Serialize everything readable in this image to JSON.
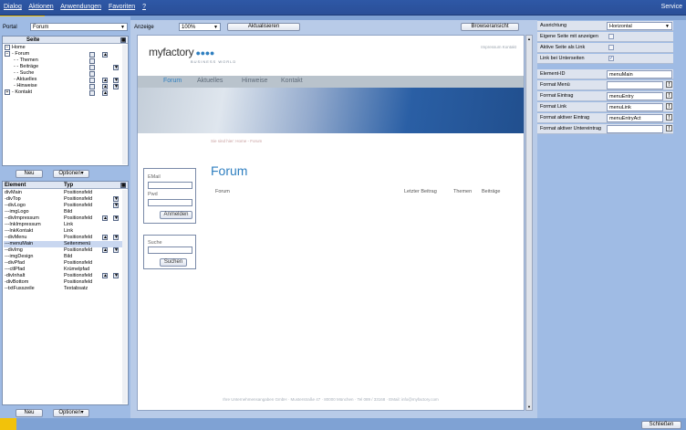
{
  "menubar": {
    "items": [
      "Dialog",
      "Aktionen",
      "Anwendungen",
      "Favoriten",
      "?"
    ],
    "service": "Service"
  },
  "left": {
    "portal_label": "Portal",
    "portal_value": "Forum",
    "tree_header": "Seite",
    "tree_items": [
      "Home",
      "- Forum",
      "- - Themen",
      "- - Beiträge",
      "- - Suche",
      "- Aktuelles",
      "- Hinweise",
      "- Kontakt"
    ],
    "new_label": "Neu",
    "options_label": "Optionen▾",
    "table_headers": [
      "Element",
      "Typ"
    ],
    "rows": [
      {
        "e": "divMain",
        "t": "Positionsfeld"
      },
      {
        "e": "-divTop",
        "t": "Positionsfeld"
      },
      {
        "e": "--divLogo",
        "t": "Positionsfeld"
      },
      {
        "e": "---imgLogo",
        "t": "Bild"
      },
      {
        "e": "--divImpressum",
        "t": "Positionsfeld"
      },
      {
        "e": "---lnkImpressum",
        "t": "Link"
      },
      {
        "e": "---lnkKontakt",
        "t": "Link"
      },
      {
        "e": "--divMenu",
        "t": "Positionsfeld"
      },
      {
        "e": "---menuMain",
        "t": "Seitenmenü"
      },
      {
        "e": "--divImg",
        "t": "Positionsfeld"
      },
      {
        "e": "---imgDesign",
        "t": "Bild"
      },
      {
        "e": "--divPfad",
        "t": "Positionsfeld"
      },
      {
        "e": "---ctlPfad",
        "t": "Krümelpfad"
      },
      {
        "e": "-divInhalt",
        "t": "Positionsfeld"
      },
      {
        "e": "-divBottom",
        "t": "Positionsfeld"
      },
      {
        "e": "--txtFusszeile",
        "t": "Textabsatz"
      }
    ]
  },
  "center": {
    "anzeige_label": "Anzeige",
    "zoom": "100%",
    "refresh": "Aktualisieren",
    "browser_view": "Browseransicht",
    "site": {
      "logo_main": "myfactory",
      "logo_sub": "BUSINESS WORLD",
      "top_links": "Impressum  Kontakt",
      "nav": [
        "Forum",
        "Aktuelles",
        "Hinweise",
        "Kontakt"
      ],
      "breadcrumb": "Sie sind hier: Home - Forum",
      "email_label": "EMail",
      "pwd_label": "Pwd",
      "login_btn": "Anmelden",
      "search_label": "Suche",
      "search_btn": "Suchen",
      "page_title": "Forum",
      "col_forum": "Forum",
      "col_last": "Letzter Beitrag",
      "col_topics": "Themen",
      "col_posts": "Beiträge",
      "footer": "Ihre Unternehmensangaben GmbH · Musterstraße 47 · 80000 München · Tel 089 / 33168 · EMail: info@myfactory.com"
    }
  },
  "right": {
    "props": [
      {
        "k": "Ausrichtung",
        "type": "select",
        "v": "Horizontal"
      },
      {
        "k": "Eigene Seite mit anzeigen",
        "type": "check",
        "v": ""
      },
      {
        "k": "Aktive Seite als Link",
        "type": "check",
        "v": ""
      },
      {
        "k": "Link bei Unterseiten",
        "type": "check",
        "v": "✓"
      }
    ],
    "attrs": [
      {
        "k": "Element-ID",
        "v": "menuMain",
        "bang": false
      },
      {
        "k": "Format Menü",
        "v": "",
        "bang": true
      },
      {
        "k": "Format Eintrag",
        "v": "menuEntry",
        "bang": true
      },
      {
        "k": "Format Link",
        "v": "menuLink",
        "bang": true
      },
      {
        "k": "Format aktiver Eintrag",
        "v": "menuEntryAct",
        "bang": true
      },
      {
        "k": "Format aktiver Untereintrag",
        "v": "",
        "bang": true
      }
    ],
    "close": "Schließen"
  }
}
